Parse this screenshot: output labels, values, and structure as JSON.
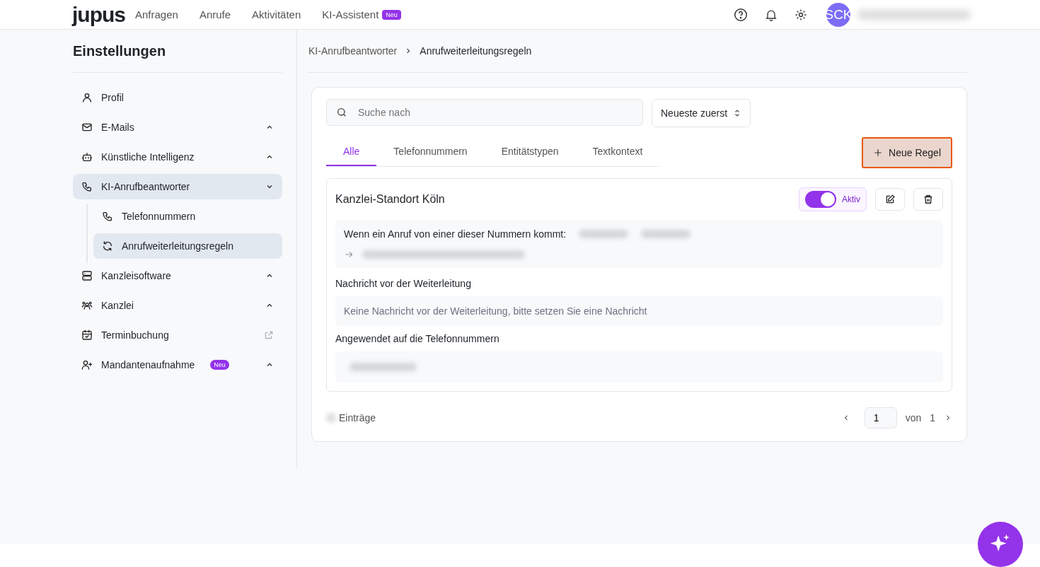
{
  "header": {
    "logo": "jupus",
    "nav": [
      {
        "label": "Anfragen"
      },
      {
        "label": "Anrufe"
      },
      {
        "label": "Aktivitäten"
      },
      {
        "label": "KI-Assistent",
        "badge": "Neu"
      }
    ],
    "avatar": "SCK"
  },
  "sidebar": {
    "title": "Einstellungen",
    "items": [
      {
        "label": "Profil",
        "kind": "page",
        "selected": false
      },
      {
        "label": "E-Mails",
        "kind": "group",
        "expanded": false,
        "selected": false
      },
      {
        "label": "Künstliche Intelligenz",
        "kind": "group",
        "expanded": false,
        "selected": false
      },
      {
        "label": "KI-Anrufbeantworter",
        "kind": "group",
        "expanded": true,
        "selected": true,
        "children": [
          {
            "label": "Telefonnummern",
            "selected": false
          },
          {
            "label": "Anrufweiterleitungsregeln",
            "selected": true
          }
        ]
      },
      {
        "label": "Kanzleisoftware",
        "kind": "group",
        "expanded": false,
        "selected": false
      },
      {
        "label": "Kanzlei",
        "kind": "group",
        "expanded": false,
        "selected": false
      },
      {
        "label": "Terminbuchung",
        "kind": "external",
        "selected": false
      },
      {
        "label": "Mandantenaufnahme",
        "kind": "group",
        "expanded": false,
        "selected": false,
        "badge": "Neu"
      }
    ]
  },
  "breadcrumb": [
    "KI-Anrufbeantworter",
    "Anrufweiterleitungsregeln"
  ],
  "search": {
    "placeholder": "Suche nach"
  },
  "sort": "Neueste zuerst",
  "tabs": [
    {
      "label": "Alle",
      "selected": true
    },
    {
      "label": "Telefonnummern",
      "selected": false
    },
    {
      "label": "Entitätstypen",
      "selected": false
    },
    {
      "label": "Textkontext",
      "selected": false
    }
  ],
  "new_button": "Neue Regel",
  "rule": {
    "title": "Kanzlei-Standort Köln",
    "active": true,
    "active_label": "Aktiv",
    "condition": "Wenn ein Anruf von einer dieser Nummern kommt:",
    "message_label": "Nachricht vor der Weiterleitung",
    "message_empty": "Keine Nachricht vor der Weiterleitung, bitte setzen Sie eine Nachricht",
    "applied_label": "Angewendet auf die Telefonnummern"
  },
  "pagination": {
    "entries_label": "Einträge",
    "page": "1",
    "of_label": "von",
    "total": "1"
  }
}
